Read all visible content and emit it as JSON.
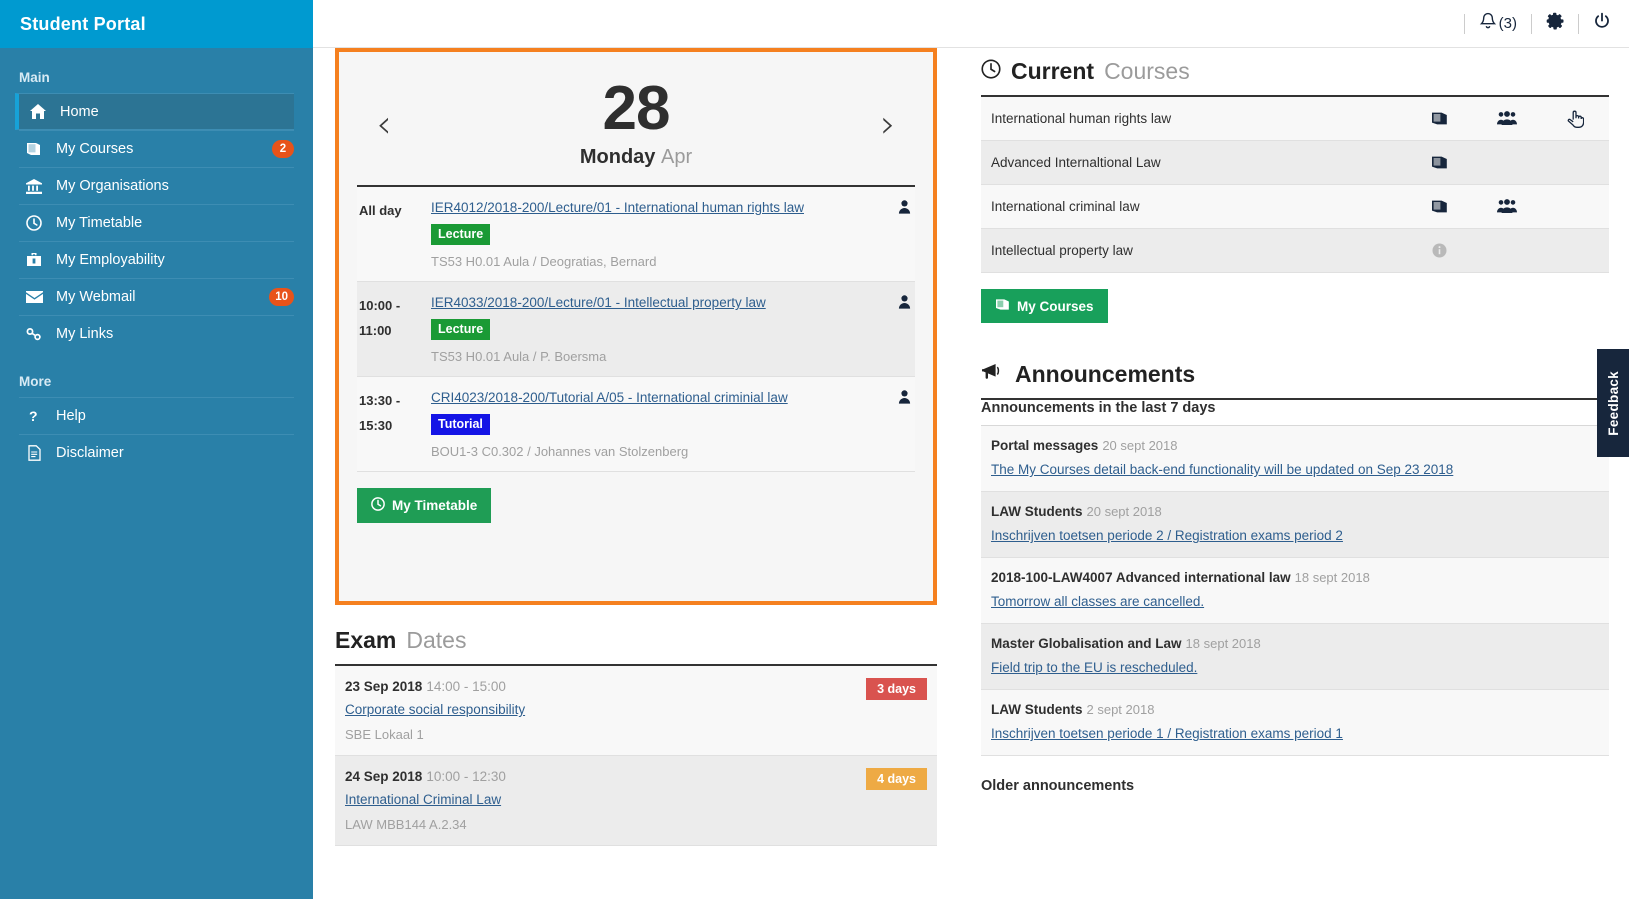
{
  "brand": {
    "title": "Student Portal"
  },
  "topbar": {
    "notifications_label": "(3)",
    "bell_icon": "bell-icon",
    "gear_icon": "gear-icon",
    "power_icon": "power-icon"
  },
  "sidebar": {
    "sections": [
      {
        "label": "Main",
        "items": [
          {
            "label": "Home",
            "icon": "home-icon",
            "badge": "",
            "active": true
          },
          {
            "label": "My Courses",
            "icon": "book-icon",
            "badge": "2",
            "active": false
          },
          {
            "label": "My Organisations",
            "icon": "bank-icon",
            "badge": "",
            "active": false
          },
          {
            "label": "My Timetable",
            "icon": "clock-icon",
            "badge": "",
            "active": false
          },
          {
            "label": "My Employability",
            "icon": "briefcase-icon",
            "badge": "",
            "active": false
          },
          {
            "label": "My Webmail",
            "icon": "envelope-icon",
            "badge": "10",
            "active": false
          },
          {
            "label": "My Links",
            "icon": "link-icon",
            "badge": "",
            "active": false
          }
        ]
      },
      {
        "label": "More",
        "items": [
          {
            "label": "Help",
            "icon": "question-icon",
            "badge": "",
            "active": false
          },
          {
            "label": "Disclaimer",
            "icon": "file-icon",
            "badge": "",
            "active": false
          }
        ]
      }
    ]
  },
  "calendar": {
    "prev_arrow": "‹",
    "next_arrow": "›",
    "day_number": "28",
    "weekday": "Monday",
    "month": "Apr",
    "events": [
      {
        "time": "All day",
        "time2": "",
        "title": "IER4012/2018-200/Lecture/01 - International human rights law",
        "tag": "Lecture",
        "tag_type": "lecture",
        "meta": "TS53 H0.01 Aula / Deogratias, Bernard",
        "person_icon": "person-icon"
      },
      {
        "time": "10:00 -",
        "time2": "11:00",
        "title": "IER4033/2018-200/Lecture/01 - Intellectual property law",
        "tag": "Lecture",
        "tag_type": "lecture",
        "meta": "TS53 H0.01 Aula / P. Boersma",
        "person_icon": "person-icon"
      },
      {
        "time": "13:30 -",
        "time2": "15:30",
        "title": "CRI4023/2018-200/Tutorial A/05 - International criminial law",
        "tag": "Tutorial",
        "tag_type": "tutorial",
        "meta": "BOU1-3 C0.302 / Johannes van Stolzenberg",
        "person_icon": "person-icon"
      }
    ],
    "button_label": "My Timetable",
    "button_icon": "clock-icon"
  },
  "exam_dates": {
    "heading_strong": "Exam",
    "heading_light": "Dates",
    "rows": [
      {
        "date": "23 Sep 2018",
        "time": "14:00 - 15:00",
        "title": "Corporate social responsibility",
        "location": "SBE Lokaal 1",
        "badge": "3 days",
        "badge_color": "red"
      },
      {
        "date": "24 Sep 2018",
        "time": "10:00 - 12:30",
        "title": "International Criminal Law",
        "location": "LAW MBB144 A.2.34",
        "badge": "4 days",
        "badge_color": "orange"
      }
    ]
  },
  "current_courses": {
    "heading_icon": "clock-icon",
    "heading_strong": "Current",
    "heading_light": "Courses",
    "rows": [
      {
        "name": "International human rights law",
        "icons": [
          {
            "name": "book-icon",
            "muted": false
          },
          {
            "name": "group-icon",
            "muted": false
          },
          {
            "name": "hand-pointer-icon",
            "muted": false
          }
        ]
      },
      {
        "name": "Advanced Internaltional Law",
        "icons": [
          {
            "name": "book-icon",
            "muted": false
          }
        ]
      },
      {
        "name": "International criminal law",
        "icons": [
          {
            "name": "book-icon",
            "muted": false
          },
          {
            "name": "group-icon",
            "muted": false
          }
        ]
      },
      {
        "name": "Intellectual property law",
        "icons": [
          {
            "name": "info-icon",
            "muted": true
          }
        ]
      }
    ],
    "button_label": "My Courses",
    "button_icon": "book-icon"
  },
  "announcements": {
    "heading_icon": "megaphone-icon",
    "heading": "Announcements",
    "subheading": "Announcements in the last 7 days",
    "rows": [
      {
        "source": "Portal messages",
        "date": "20 sept 2018",
        "link": "The My Courses detail back-end functionality will be updated on Sep 23 2018"
      },
      {
        "source": "LAW Students",
        "date": "20 sept 2018",
        "link": "Inschrijven toetsen periode 2 / Registration exams period 2"
      },
      {
        "source": "2018-100-LAW4007 Advanced international law",
        "date": "18 sept 2018",
        "link": "Tomorrow all classes are cancelled."
      },
      {
        "source": "Master Globalisation and Law",
        "date": "18 sept 2018",
        "link": "Field trip to the EU is rescheduled."
      },
      {
        "source": "LAW Students",
        "date": "2 sept 2018",
        "link": "Inschrijven toetsen periode 1 / Registration exams period 1"
      }
    ],
    "older_label": "Older announcements"
  },
  "feedback": {
    "label": "Feedback"
  },
  "colors": {
    "brand_blue": "#009ad0",
    "sidebar_blue": "#2980a8",
    "sidebar_active": "#2c7494",
    "accent_orange": "#f5801f",
    "badge_orange": "#e8531a",
    "green_button": "#1f9d55",
    "lecture_green": "#1a9a35",
    "tutorial_blue": "#1414e6",
    "link_blue": "#2e5e8e",
    "dark_navy": "#17263c",
    "badge_red": "#d9534f",
    "badge_amber": "#eeaa44"
  }
}
